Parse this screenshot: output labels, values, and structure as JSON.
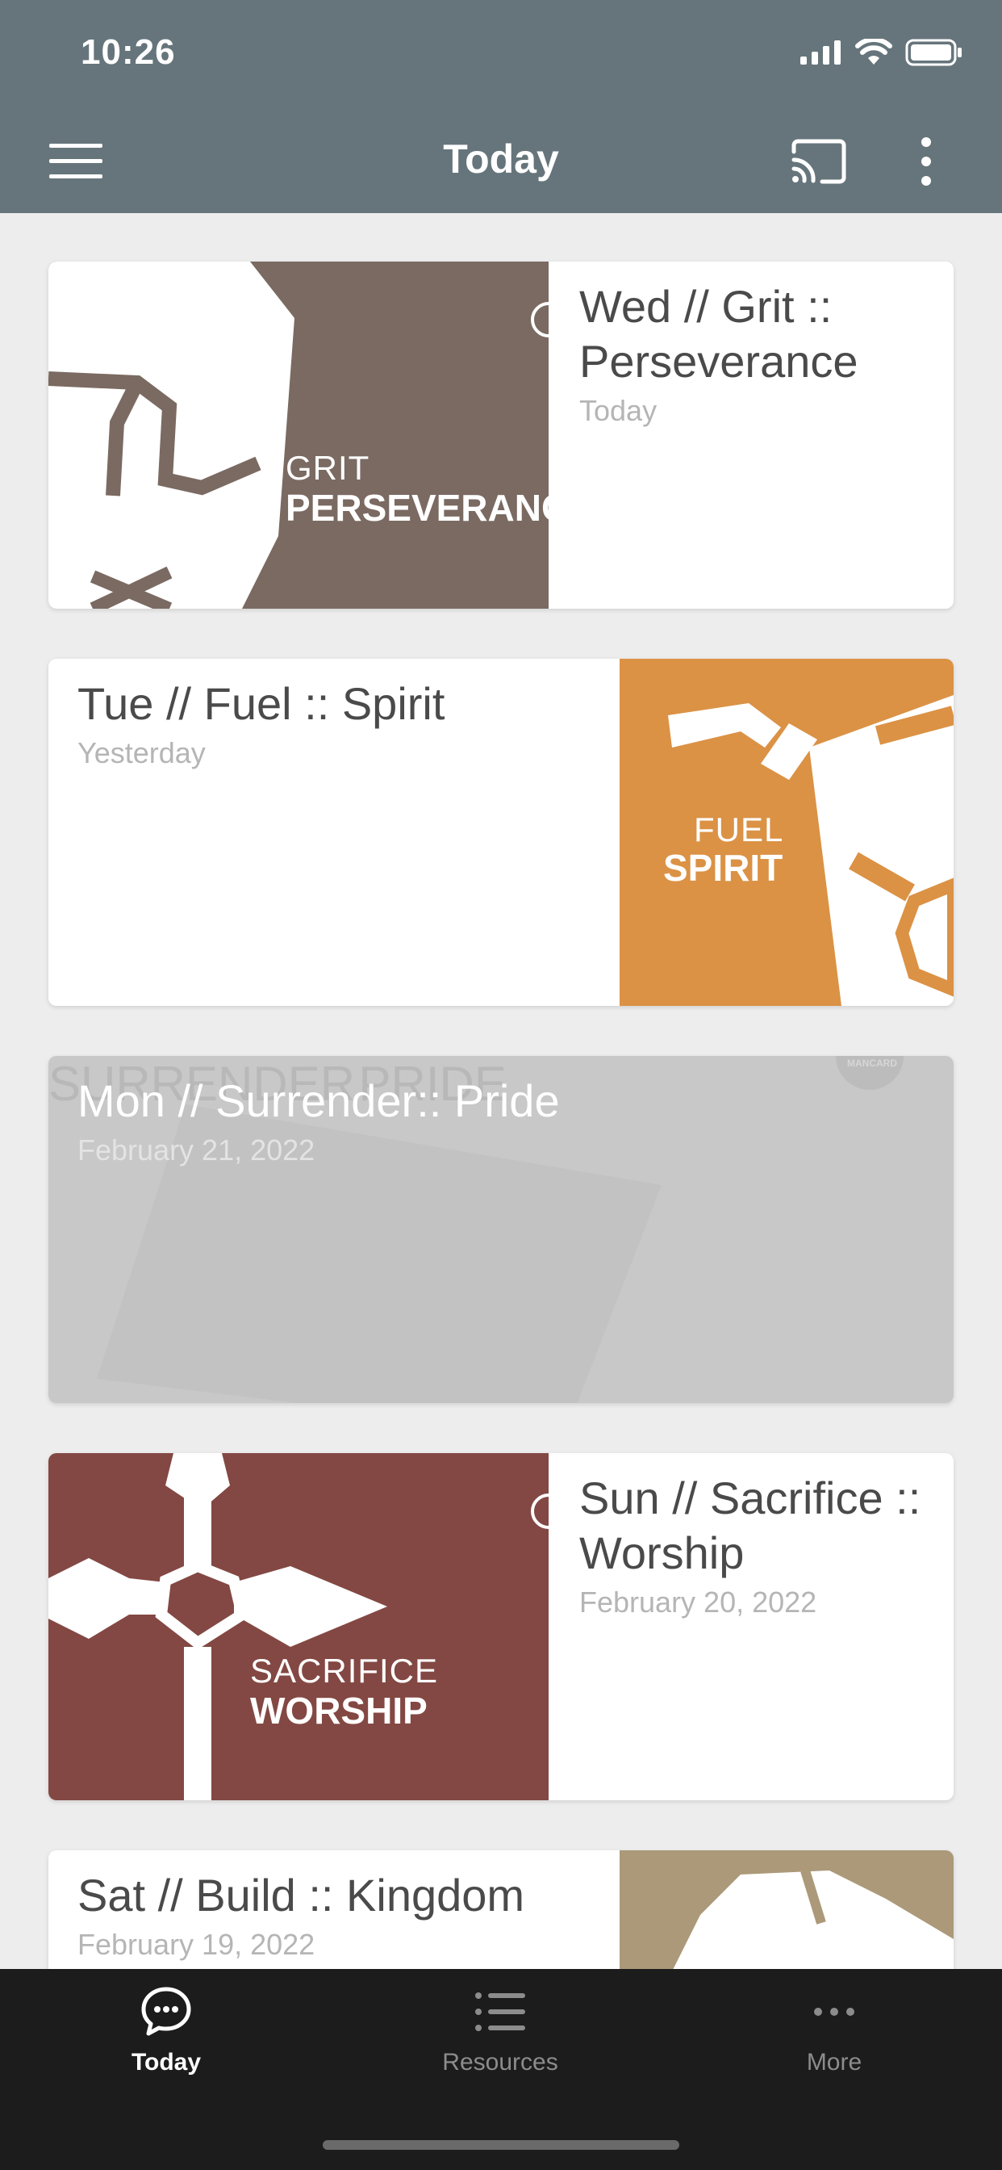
{
  "status_bar": {
    "time": "10:26"
  },
  "nav": {
    "title": "Today",
    "icons": [
      "menu-icon",
      "cast-icon",
      "more-vertical-icon"
    ]
  },
  "cards": [
    {
      "title": "Wed // Grit :: Perseverance",
      "date": "Today",
      "thumb_light": "GRIT",
      "thumb_bold": "PERSEVERANCE",
      "thumb_color": "#7a6a62"
    },
    {
      "title": "Tue // Fuel :: Spirit",
      "date": "Yesterday",
      "thumb_light": "FUEL",
      "thumb_bold": "SPIRIT",
      "thumb_color": "#db9245"
    },
    {
      "title": "Mon // Surrender:: Pride",
      "date": "February 21, 2022",
      "thumb_light": "SURRENDER",
      "thumb_bold": "PRIDE",
      "badge": "MANCARD",
      "thumb_color": "#c8c8c8"
    },
    {
      "title": "Sun // Sacrifice :: Worship",
      "date": "February 20, 2022",
      "thumb_light": "SACRIFICE",
      "thumb_bold": "WORSHIP",
      "thumb_color": "#834843"
    },
    {
      "title": "Sat // Build :: Kingdom",
      "date": "February 19, 2022",
      "thumb_color": "#ab9979"
    }
  ],
  "tabs": [
    {
      "label": "Today",
      "icon": "chat-bubble-icon",
      "active": true
    },
    {
      "label": "Resources",
      "icon": "list-icon",
      "active": false
    },
    {
      "label": "More",
      "icon": "more-horizontal-icon",
      "active": false
    }
  ],
  "colors": {
    "nav_bg": "#66757b",
    "tab_bg": "#1c1c1d",
    "page_bg": "#ededed"
  }
}
